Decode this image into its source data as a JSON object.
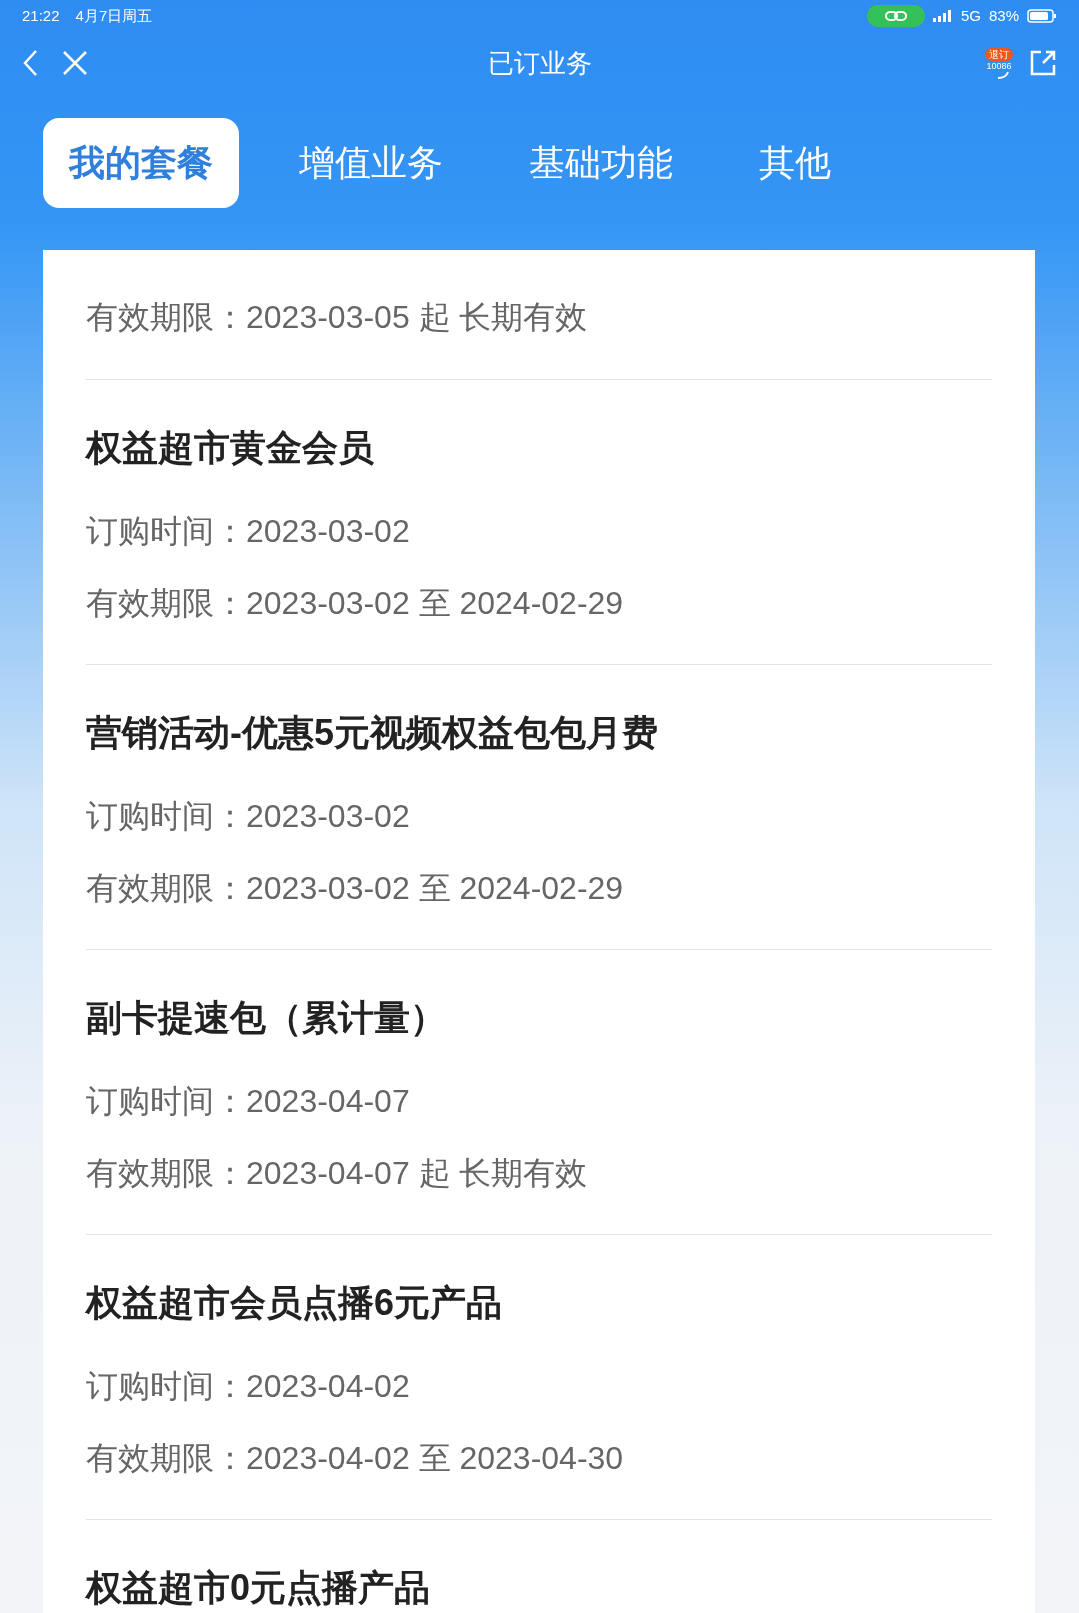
{
  "status_bar": {
    "time": "21:22",
    "date": "4月7日周五",
    "network": "5G",
    "battery": "83%"
  },
  "header": {
    "title": "已订业务",
    "badge": "退订",
    "hotline": "10086"
  },
  "tabs": [
    {
      "label": "我的套餐",
      "selected": true
    },
    {
      "label": "增值业务",
      "selected": false
    },
    {
      "label": "基础功能",
      "selected": false
    },
    {
      "label": "其他",
      "selected": false
    }
  ],
  "services": [
    {
      "validity": "有效期限：2023-03-05 起 长期有效"
    },
    {
      "title": "权益超市黄金会员",
      "ordered": "订购时间：2023-03-02",
      "validity": "有效期限：2023-03-02 至 2024-02-29"
    },
    {
      "title": "营销活动-优惠5元视频权益包包月费",
      "ordered": "订购时间：2023-03-02",
      "validity": "有效期限：2023-03-02 至 2024-02-29"
    },
    {
      "title": "副卡提速包（累计量）",
      "ordered": "订购时间：2023-04-07",
      "validity": "有效期限：2023-04-07 起 长期有效"
    },
    {
      "title": "权益超市会员点播6元产品",
      "ordered": "订购时间：2023-04-02",
      "validity": "有效期限：2023-04-02 至 2023-04-30"
    },
    {
      "title": "权益超市0元点播产品"
    }
  ]
}
